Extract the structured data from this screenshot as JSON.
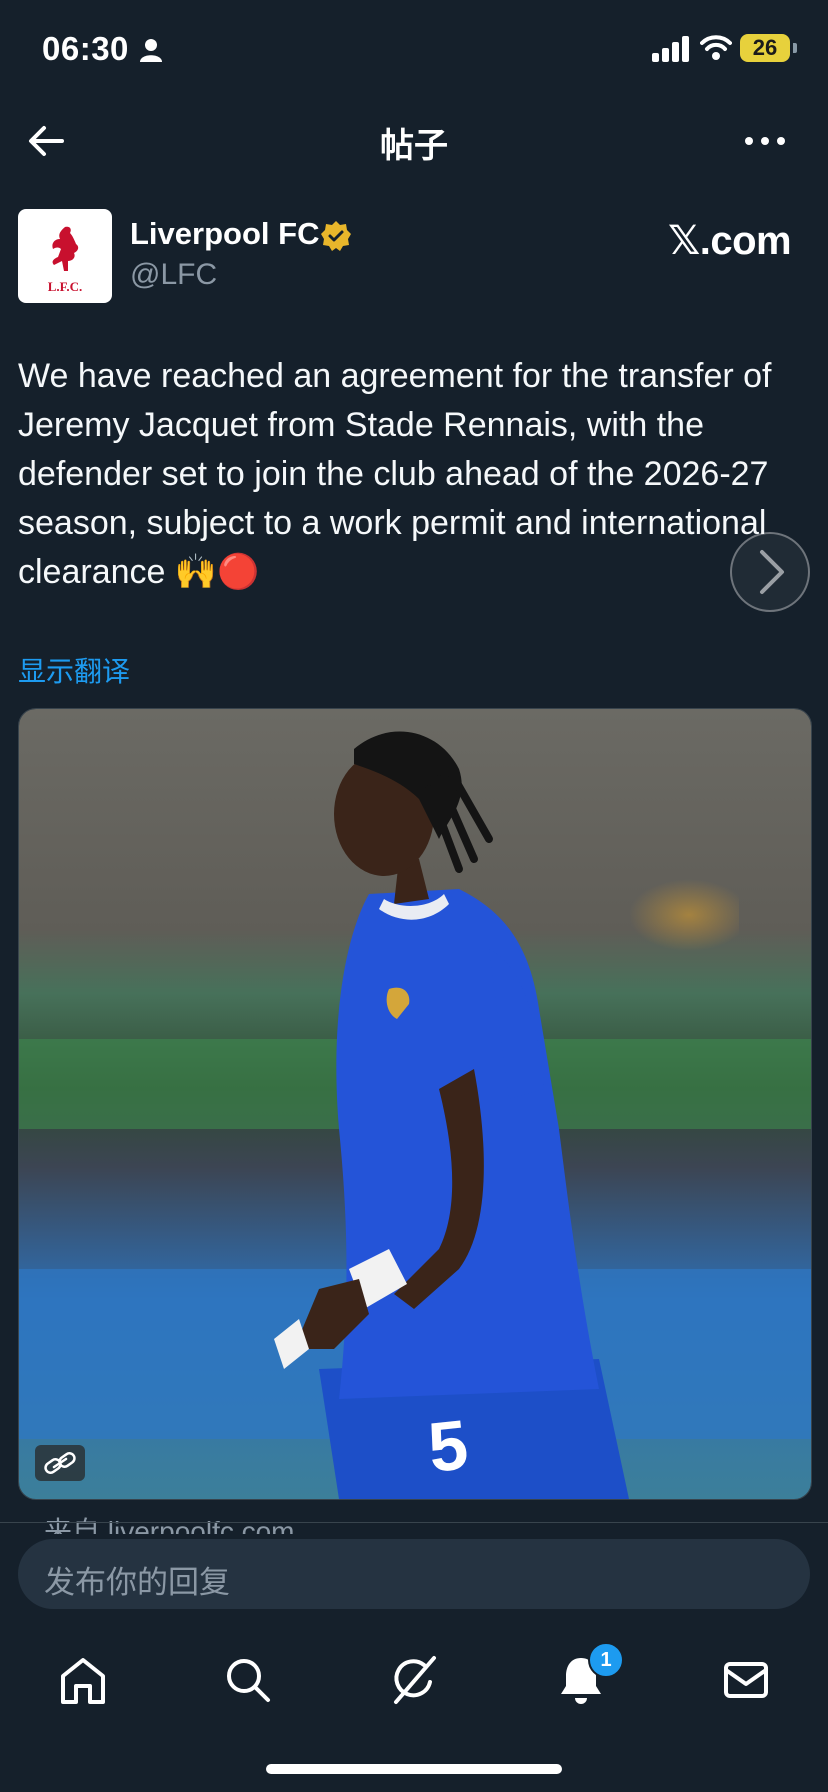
{
  "status_bar": {
    "time": "06:30",
    "battery": "26"
  },
  "header": {
    "title": "帖子"
  },
  "author": {
    "name": "Liverpool FC",
    "handle": "@LFC",
    "avatar_text": "L.F.C."
  },
  "source_brand": "𝕏.com",
  "post": {
    "text": "We have reached an agreement for the transfer of Jeremy Jacquet from Stade Rennais, with the defender set to join the club ahead of the 2026-27 season, subject to a work permit and international clearance 🙌🔴",
    "translate_label": "显示翻译",
    "shirt_number": "5",
    "link_source": "来自 liverpoolfc.com"
  },
  "reply": {
    "placeholder": "发布你的回复"
  },
  "tabs": [
    {
      "icon": "home-icon"
    },
    {
      "icon": "search-icon"
    },
    {
      "icon": "grok-icon"
    },
    {
      "icon": "notifications-icon"
    },
    {
      "icon": "messages-icon"
    }
  ],
  "notifications": {
    "badge_count": "1"
  },
  "colors": {
    "background": "#15202b",
    "accent": "#1d9bf0",
    "verified": "#e8b62b",
    "battery": "#e7d13c"
  }
}
